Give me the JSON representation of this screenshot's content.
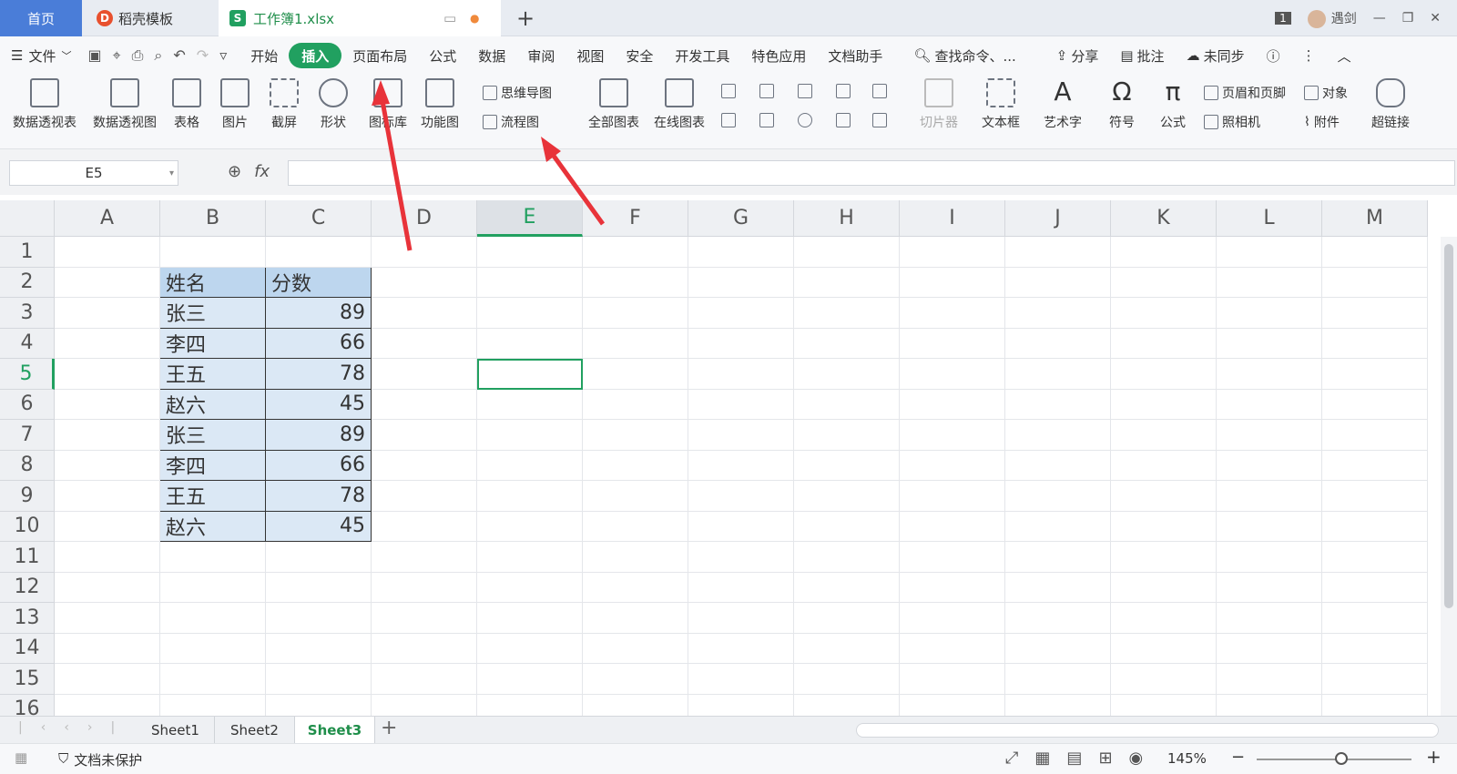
{
  "tabs": {
    "home": "首页",
    "template": "稻壳模板",
    "workbook": "工作簿1.xlsx",
    "add": "+"
  },
  "user": {
    "badge": "1",
    "name": "遇剑"
  },
  "menu": {
    "file": "文件",
    "items": [
      "开始",
      "插入",
      "页面布局",
      "公式",
      "数据",
      "审阅",
      "视图",
      "安全",
      "开发工具",
      "特色应用",
      "文档助手"
    ],
    "active": "插入",
    "search": "查找命令、...",
    "share": "分享",
    "comment": "批注",
    "sync": "未同步"
  },
  "ribbon": {
    "pivot_table": "数据透视表",
    "pivot_chart": "数据透视图",
    "table": "表格",
    "picture": "图片",
    "screenshot": "截屏",
    "shape": "形状",
    "icon_lib": "图标库",
    "func_chart": "功能图",
    "mind_map": "思维导图",
    "flowchart": "流程图",
    "all_charts": "全部图表",
    "online_charts": "在线图表",
    "slicer": "切片器",
    "textbox": "文本框",
    "wordart": "艺术字",
    "symbol": "符号",
    "formula": "公式",
    "header_footer": "页眉和页脚",
    "object": "对象",
    "camera": "照相机",
    "attachment": "附件",
    "hyperlink": "超链接"
  },
  "formula_bar": {
    "cell_ref": "E5",
    "fx": "fx",
    "value": ""
  },
  "columns": [
    "A",
    "B",
    "C",
    "D",
    "E",
    "F",
    "G",
    "H",
    "I",
    "J",
    "K",
    "L",
    "M"
  ],
  "rows": [
    "1",
    "2",
    "3",
    "4",
    "5",
    "6",
    "7",
    "8",
    "9",
    "10",
    "11",
    "12",
    "13",
    "14",
    "15",
    "16"
  ],
  "table": {
    "headers": [
      "姓名",
      "分数"
    ],
    "data": [
      [
        "张三",
        "89"
      ],
      [
        "李四",
        "66"
      ],
      [
        "王五",
        "78"
      ],
      [
        "赵六",
        "45"
      ],
      [
        "张三",
        "89"
      ],
      [
        "李四",
        "66"
      ],
      [
        "王五",
        "78"
      ],
      [
        "赵六",
        "45"
      ]
    ]
  },
  "sheets": [
    "Sheet1",
    "Sheet2",
    "Sheet3"
  ],
  "active_sheet": "Sheet3",
  "status": {
    "protect": "文档未保护",
    "zoom": "145%"
  },
  "colors": {
    "accent": "#21a060",
    "header_fill": "#bdd6ee",
    "data_fill": "#dbe8f5",
    "arrow": "#e8333a"
  }
}
